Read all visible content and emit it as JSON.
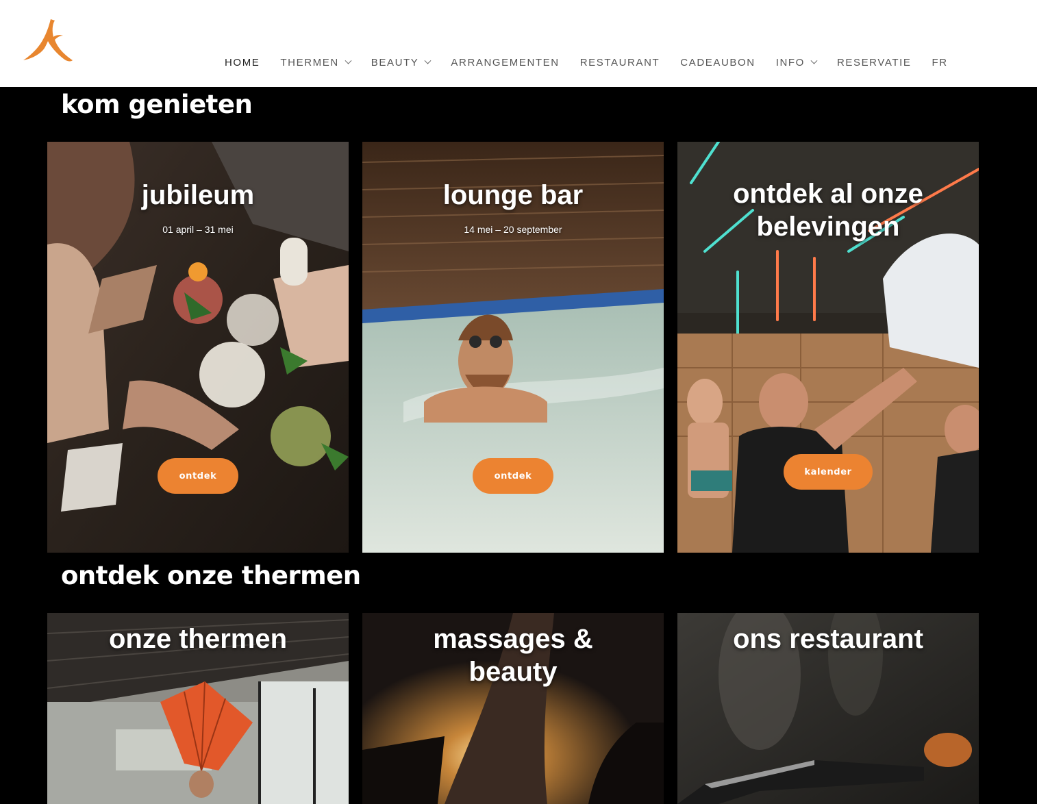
{
  "header": {
    "logo": "onsen-logo",
    "nav": [
      {
        "label": "HOME",
        "dropdown": false,
        "active": true
      },
      {
        "label": "THERMEN",
        "dropdown": true
      },
      {
        "label": "BEAUTY",
        "dropdown": true
      },
      {
        "label": "ARRANGEMENTEN",
        "dropdown": false
      },
      {
        "label": "RESTAURANT",
        "dropdown": false
      },
      {
        "label": "CADEAUBON",
        "dropdown": false
      },
      {
        "label": "INFO",
        "dropdown": true
      },
      {
        "label": "RESERVATIE",
        "dropdown": false
      },
      {
        "label": "FR",
        "dropdown": false
      }
    ]
  },
  "sections": {
    "enjoy_title": "kom genieten",
    "thermen_title": "ontdek onze thermen"
  },
  "cards_top": [
    {
      "title": "jubileum",
      "subtitle": "01 april – 31 mei",
      "button": "ontdek"
    },
    {
      "title": "lounge bar",
      "subtitle": "14 mei – 20 september",
      "button": "ontdek"
    },
    {
      "title": "ontdek al onze belevingen",
      "subtitle": "",
      "button": "kalender"
    }
  ],
  "cards_bottom": [
    {
      "title": "onze thermen"
    },
    {
      "title": "massages & beauty"
    },
    {
      "title": "ons restaurant"
    }
  ],
  "colors": {
    "accent": "#ec8331",
    "background": "#000000",
    "header": "#ffffff"
  }
}
